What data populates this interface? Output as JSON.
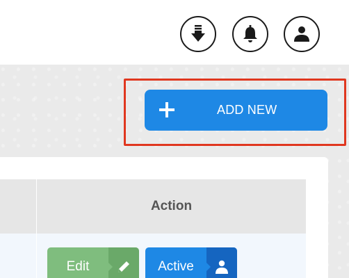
{
  "header": {
    "icons": [
      "download-icon",
      "bell-icon",
      "user-icon"
    ]
  },
  "toolbar": {
    "add_new_label": "ADD NEW"
  },
  "table": {
    "columns": [
      "",
      "Action"
    ],
    "rows": [
      {
        "actions": {
          "edit_label": "Edit",
          "status_label": "Active"
        }
      }
    ]
  },
  "colors": {
    "primary": "#1e88e5",
    "primary_dark": "#1565c0",
    "edit_green": "#7fbd7e",
    "edit_green_dark": "#6aa969",
    "highlight": "#e0371f"
  }
}
